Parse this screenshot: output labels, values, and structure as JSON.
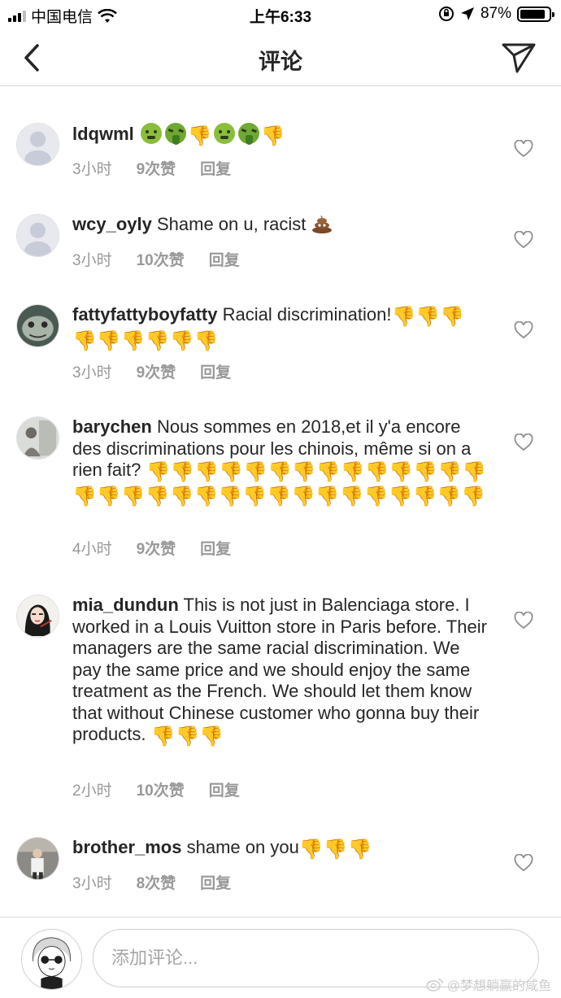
{
  "status_bar": {
    "carrier": "中国电信",
    "time": "上午6:33",
    "battery": "87%",
    "battery_level": 0.87,
    "icons": [
      "signal-icon",
      "wifi-icon",
      "rotation-lock-icon",
      "location-arrow-icon",
      "battery-icon"
    ]
  },
  "nav": {
    "title": "评论",
    "back_icon": "chevron-left-icon",
    "send_icon": "paper-plane-icon"
  },
  "comments": [
    {
      "username": "ldqwml",
      "text": "",
      "emoji_names": [
        "nauseated-face",
        "vomiting-face",
        "thumbs-down",
        "nauseated-face",
        "vomiting-face",
        "thumbs-down"
      ],
      "time": "3小时",
      "likes": "9次赞",
      "reply": "回复"
    },
    {
      "username": "wcy_oyly",
      "text": "Shame on u, racist",
      "emoji_names": [
        "pile-of-poo"
      ],
      "time": "3小时",
      "likes": "10次赞",
      "reply": "回复"
    },
    {
      "username": "fattyfattyboyfatty",
      "text": "Racial discrimination!",
      "emoji_names": [
        "thumbs-down",
        "thumbs-down",
        "thumbs-down",
        "thumbs-down",
        "thumbs-down",
        "thumbs-down",
        "thumbs-down",
        "thumbs-down",
        "thumbs-down"
      ],
      "time": "3小时",
      "likes": "9次赞",
      "reply": "回复"
    },
    {
      "username": "barychen",
      "text": "Nous sommes en 2018,et il y'a encore des discriminations pour les chinois, même si on a rien fait?",
      "emoji_names": [
        "thumbs-down",
        "thumbs-down",
        "thumbs-down",
        "thumbs-down",
        "thumbs-down",
        "thumbs-down",
        "thumbs-down",
        "thumbs-down",
        "thumbs-down",
        "thumbs-down",
        "thumbs-down",
        "thumbs-down",
        "thumbs-down",
        "thumbs-down",
        "thumbs-down",
        "thumbs-down",
        "thumbs-down",
        "thumbs-down",
        "thumbs-down",
        "thumbs-down",
        "thumbs-down",
        "thumbs-down",
        "thumbs-down",
        "thumbs-down",
        "thumbs-down",
        "thumbs-down",
        "thumbs-down",
        "thumbs-down",
        "thumbs-down",
        "thumbs-down",
        "thumbs-down"
      ],
      "time": "4小时",
      "likes": "9次赞",
      "reply": "回复"
    },
    {
      "username": "mia_dundun",
      "text": "This is not just in Balenciaga store. I worked in a Louis Vuitton store in Paris before. Their managers are the same racial discrimination. We pay the same price and we should enjoy the same treatment as the French. We should let them know that without Chinese customer who gonna buy their products.",
      "emoji_names": [
        "thumbs-down",
        "thumbs-down",
        "thumbs-down"
      ],
      "time": "2小时",
      "likes": "10次赞",
      "reply": "回复"
    },
    {
      "username": "brother_mos",
      "text": "shame on you",
      "emoji_names": [
        "thumbs-down",
        "thumbs-down",
        "thumbs-down"
      ],
      "time": "3小时",
      "likes": "8次赞",
      "reply": "回复"
    }
  ],
  "composer": {
    "placeholder": "添加评论...",
    "value": ""
  },
  "watermark": "@梦想躺赢的咸鱼",
  "colors": {
    "text": "#262626",
    "meta": "#999999",
    "divider": "#dbdbdb",
    "thumb": "#f2b525"
  }
}
